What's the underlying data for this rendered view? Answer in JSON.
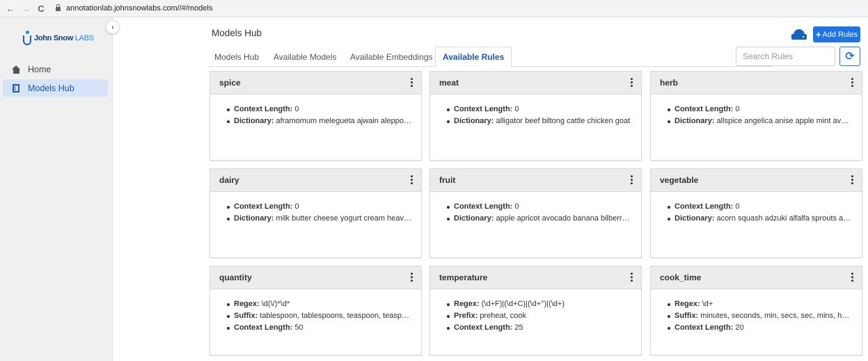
{
  "browser": {
    "back": "←",
    "forward": "→",
    "reload": "C",
    "url": "annotationlab.johnsnowlabs.com//#/models"
  },
  "logo": {
    "brand": "John Snow",
    "labs": "LABS"
  },
  "sidebar": {
    "collapse": "‹",
    "items": [
      {
        "label": "Home",
        "icon": "home-icon",
        "active": false
      },
      {
        "label": "Models Hub",
        "icon": "building-icon",
        "active": true
      }
    ]
  },
  "header": {
    "title": "Models Hub",
    "add_rules_label": "Add Rules",
    "add_rules_plus": "+",
    "refresh_symbol": "⟳"
  },
  "tabs": [
    {
      "label": "Models Hub",
      "active": false
    },
    {
      "label": "Available Models",
      "active": false
    },
    {
      "label": "Available Embeddings",
      "active": false
    },
    {
      "label": "Available Rules",
      "active": true
    }
  ],
  "search": {
    "placeholder": "Search Rules",
    "value": ""
  },
  "cards": [
    {
      "title": "spice",
      "fields": [
        {
          "key": "Context Length:",
          "value": "0"
        },
        {
          "key": "Dictionary:",
          "value": "aframomum melegueta ajwain aleppo pepper"
        }
      ]
    },
    {
      "title": "meat",
      "fields": [
        {
          "key": "Context Length:",
          "value": "0"
        },
        {
          "key": "Dictionary:",
          "value": "alligator beef biltong cattle chicken goat"
        }
      ]
    },
    {
      "title": "herb",
      "fields": [
        {
          "key": "Context Length:",
          "value": "0"
        },
        {
          "key": "Dictionary:",
          "value": "allspice angelica anise apple mint avocado leaf"
        }
      ]
    },
    {
      "title": "dairy",
      "fields": [
        {
          "key": "Context Length:",
          "value": "0"
        },
        {
          "key": "Dictionary:",
          "value": "milk butter cheese yogurt cream heavy cream"
        }
      ]
    },
    {
      "title": "fruit",
      "fields": [
        {
          "key": "Context Length:",
          "value": "0"
        },
        {
          "key": "Dictionary:",
          "value": "apple apricot avocado banana bilberry blackberry"
        }
      ]
    },
    {
      "title": "vegetable",
      "fields": [
        {
          "key": "Context Length:",
          "value": "0"
        },
        {
          "key": "Dictionary:",
          "value": "acorn squash adzuki alfalfa sprouts artichoke"
        }
      ]
    },
    {
      "title": "quantity",
      "fields": [
        {
          "key": "Regex:",
          "value": "\\d(\\/)*\\d*"
        },
        {
          "key": "Suffix:",
          "value": "tablespoon, tablespoons, teaspoon, teaspoons"
        },
        {
          "key": "Context Length:",
          "value": "50"
        }
      ]
    },
    {
      "title": "temperature",
      "fields": [
        {
          "key": "Regex:",
          "value": "(\\d+F)|(\\d+C)|(\\d+°)|(\\d+)"
        },
        {
          "key": "Prefix:",
          "value": "preheat, cook"
        },
        {
          "key": "Context Length:",
          "value": "25"
        }
      ]
    },
    {
      "title": "cook_time",
      "fields": [
        {
          "key": "Regex:",
          "value": "\\d+"
        },
        {
          "key": "Suffix:",
          "value": "minutes, seconds, min, secs, sec, mins, hour, hours"
        },
        {
          "key": "Context Length:",
          "value": "20"
        }
      ]
    }
  ]
}
